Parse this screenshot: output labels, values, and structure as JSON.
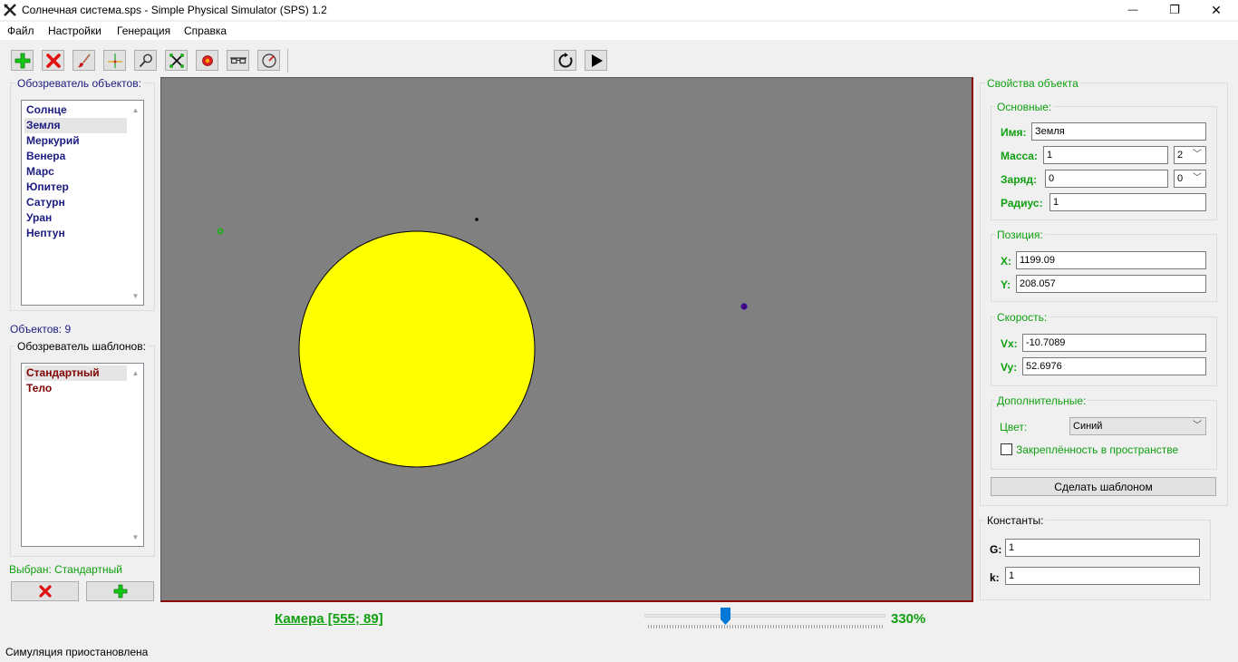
{
  "window": {
    "title": "Солнечная система.sps - Simple Physical Simulator (SPS) 1.2",
    "minimize_glyph": "—",
    "maximize_glyph": "❐",
    "close_glyph": "✕"
  },
  "menu": [
    "Файл",
    "Настройки",
    "Генерация",
    "Справка"
  ],
  "toolbar": {
    "tools": [
      "add-icon",
      "delete-icon",
      "brush-icon",
      "crosshair-icon",
      "magnifier-icon",
      "scissors-x-icon",
      "record-icon",
      "glasses-icon",
      "compass-icon"
    ],
    "controls": [
      "reset-icon",
      "play-icon"
    ]
  },
  "object_browser": {
    "title": "Обозреватель объектов:",
    "items": [
      "Солнце",
      "Земля",
      "Меркурий",
      "Венера",
      "Марс",
      "Юпитер",
      "Сатурн",
      "Уран",
      "Нептун"
    ],
    "selected": "Земля",
    "count_label": "Объектов: 9"
  },
  "template_browser": {
    "title": "Обозреватель шаблонов:",
    "items": [
      "Стандартный",
      "Тело"
    ],
    "selected": "Стандартный",
    "selected_label": "Выбран: Стандартный"
  },
  "canvas": {
    "background": "#808080",
    "sun_color": "#ffff00",
    "bodies_colors": [
      "#00c000",
      "#000000",
      "#4b0082"
    ]
  },
  "camera": {
    "label": "Камера [555; 89]",
    "zoom_label": "330%",
    "zoom_slider_fraction": 0.33
  },
  "properties": {
    "title": "Свойства объекта",
    "basic": {
      "title": "Основные:",
      "name_label": "Имя:",
      "name": "Земля",
      "mass_label": "Масса:",
      "mass": "1",
      "mass_exp": "2",
      "charge_label": "Заряд:",
      "charge": "0",
      "charge_exp": "0",
      "radius_label": "Радиус:",
      "radius": "1"
    },
    "position": {
      "title": "Позиция:",
      "x_label": "X:",
      "x": "1199.09",
      "y_label": "Y:",
      "y": "208.057"
    },
    "velocity": {
      "title": "Скорость:",
      "vx_label": "Vx:",
      "vx": "-10.7089",
      "vy_label": "Vy:",
      "vy": "52.6976"
    },
    "extra": {
      "title": "Дополнительные:",
      "color_label": "Цвет:",
      "color": "Синий",
      "fixed_label": "Закреплённость в пространстве",
      "fixed": false
    },
    "make_template_button": "Сделать шаблоном"
  },
  "constants": {
    "title": "Константы:",
    "g_label": "G:",
    "g": "1",
    "k_label": "k:",
    "k": "1"
  },
  "status": "Симуляция приостановлена"
}
